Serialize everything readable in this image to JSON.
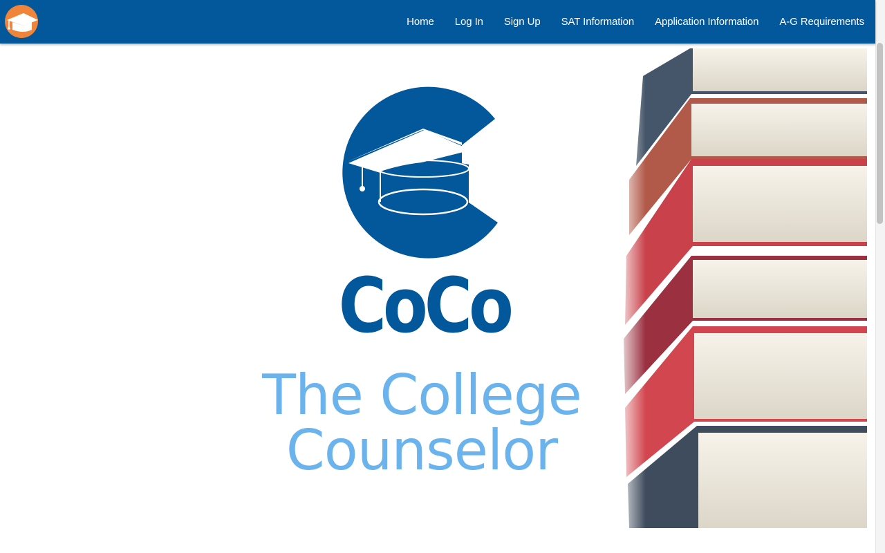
{
  "nav": {
    "items": [
      {
        "label": "Home"
      },
      {
        "label": "Log In"
      },
      {
        "label": "Sign Up"
      },
      {
        "label": "SAT Information"
      },
      {
        "label": "Application Information"
      },
      {
        "label": "A-G Requirements"
      }
    ]
  },
  "hero": {
    "brand_name": "CoCo",
    "tagline_line1": "The College",
    "tagline_line2": "Counselor"
  },
  "colors": {
    "navbar": "#03579b",
    "logo_blue": "#03579b",
    "tagline": "#6ab3ec",
    "nav_logo_orange": "#f0843a"
  },
  "icons": {
    "nav_logo": "graduation-cap-logo-icon",
    "hero_logo": "graduation-cap-c-logo-icon",
    "books": "stacked-books-image"
  }
}
